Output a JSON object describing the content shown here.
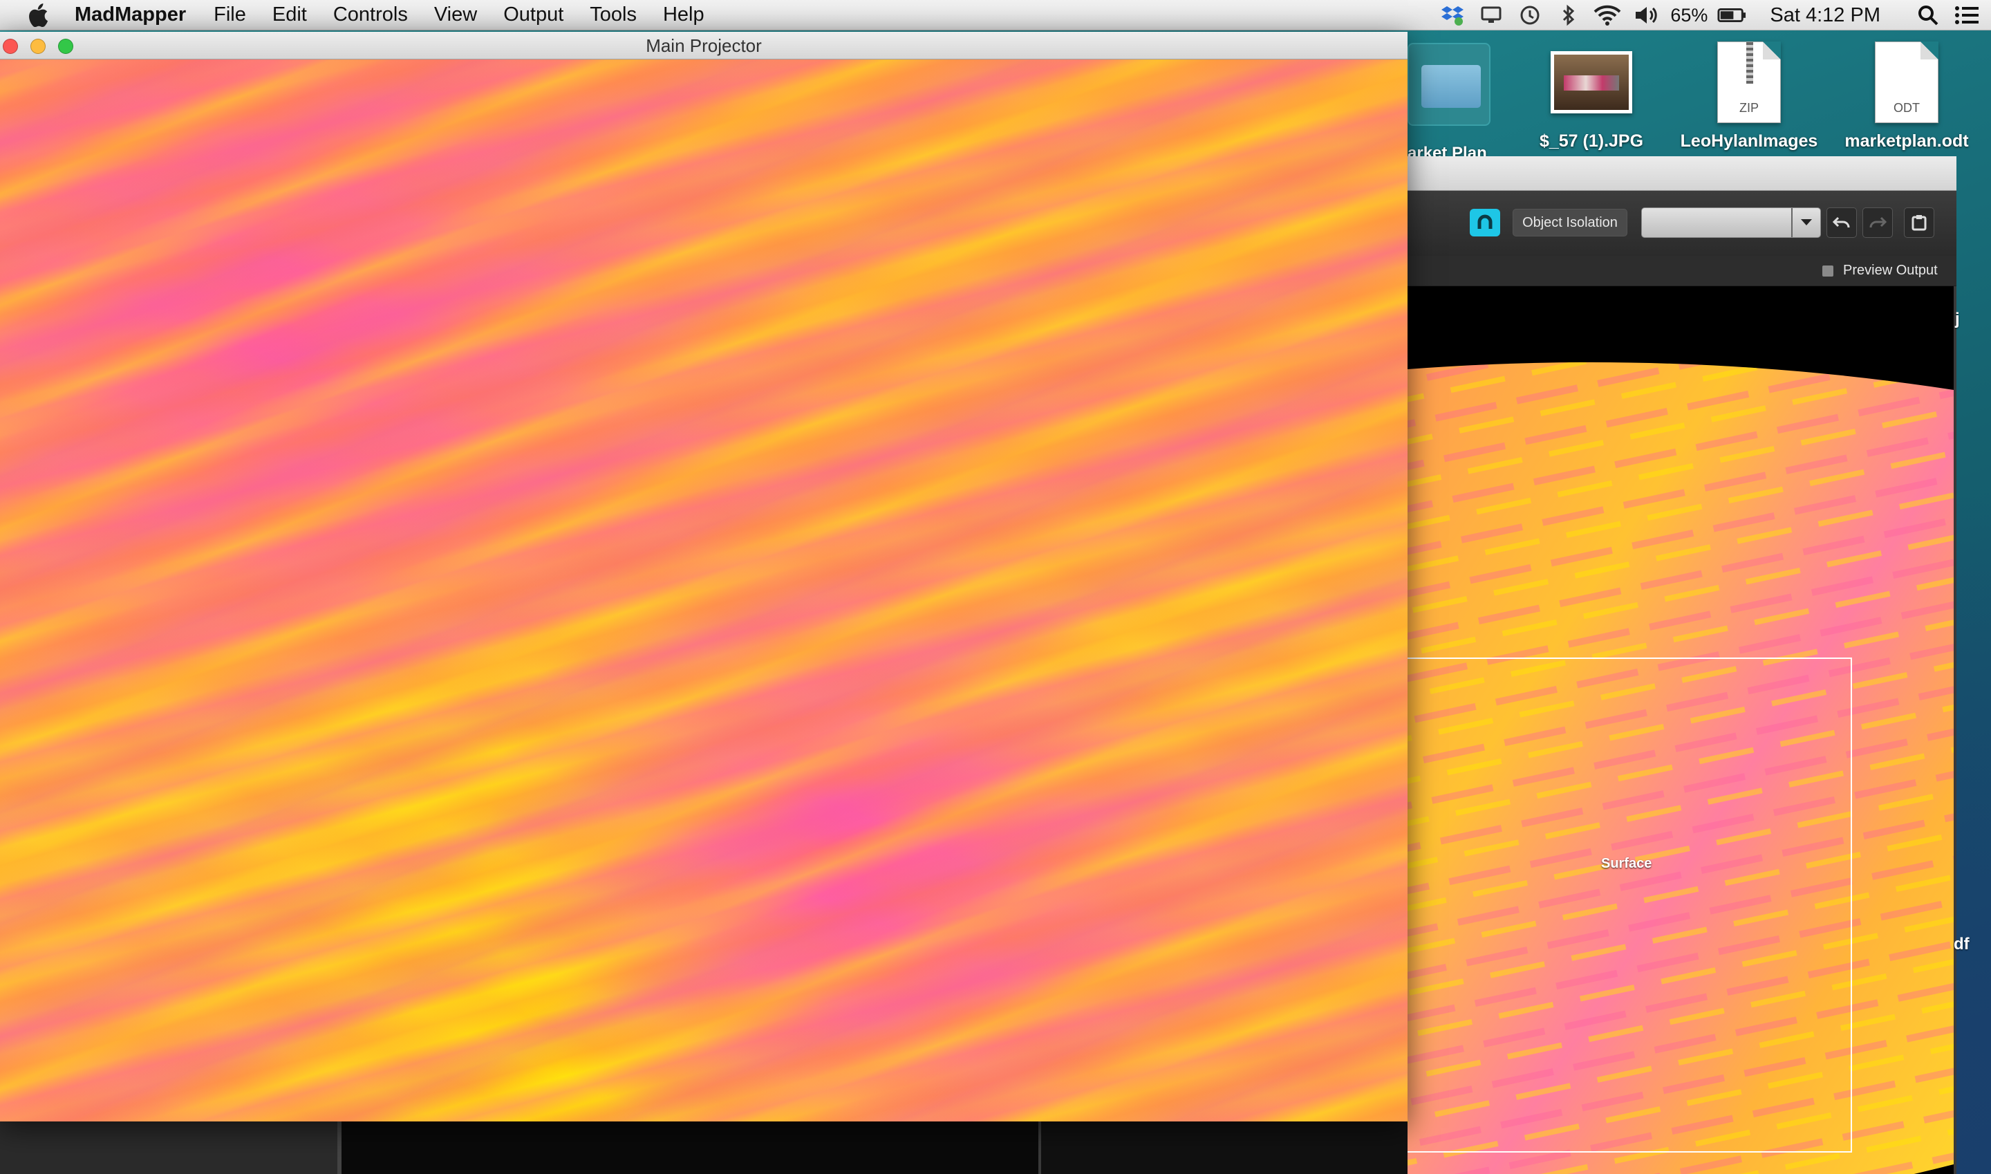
{
  "menubar": {
    "app_name": "MadMapper",
    "items": [
      "File",
      "Edit",
      "Controls",
      "View",
      "Output",
      "Tools",
      "Help"
    ],
    "battery": "65%",
    "clock": "Sat 4:12 PM",
    "icons": [
      "dropbox-icon",
      "display-icon",
      "time-machine-icon",
      "bluetooth-icon",
      "wifi-icon",
      "volume-icon",
      "battery-icon",
      "spotlight-icon",
      "notification-center-icon"
    ]
  },
  "desktop": {
    "folder_label": "arket Plan",
    "icons": [
      {
        "label": "$_57 (1).JPG",
        "type": "image"
      },
      {
        "label": "LeoHylanImages",
        "type": "zip",
        "ext": "ZIP"
      },
      {
        "label": "marketplan.odt",
        "type": "document",
        "ext": "ODT"
      }
    ],
    "side_text_1": "j",
    "side_text_2": "df"
  },
  "projector_window": {
    "title": "Main Projector"
  },
  "madmapper_window": {
    "object_isolation_label": "Object Isolation",
    "select_value": "",
    "preview_output_label": "Preview Output",
    "preview_output_checked": false,
    "surface_label": "Surface"
  },
  "colors": {
    "accent": "#1ec6e6",
    "canvas_pink": "#ff5aa0",
    "canvas_orange": "#ffb23c",
    "canvas_yellow": "#ffe600"
  }
}
